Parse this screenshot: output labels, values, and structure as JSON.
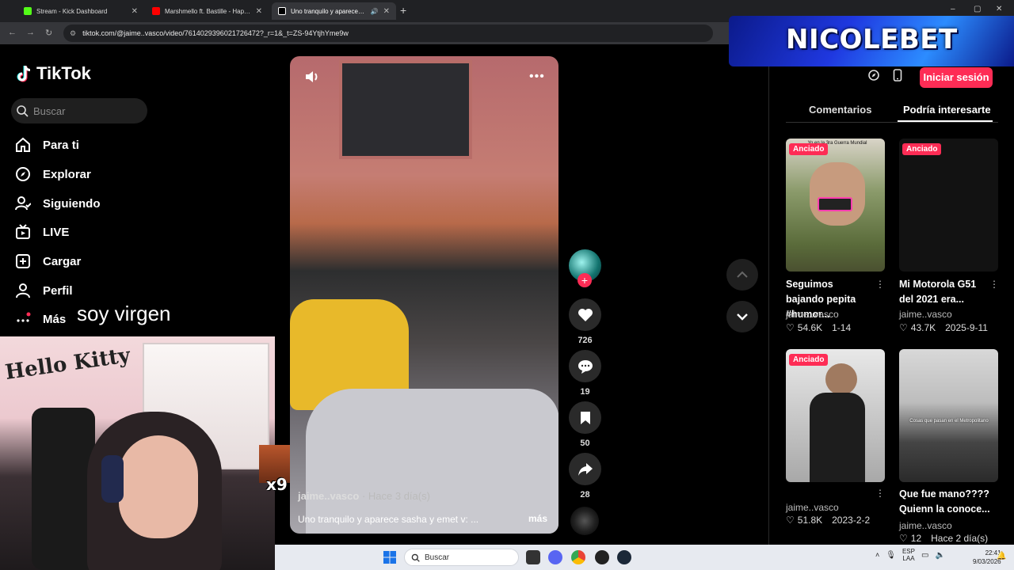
{
  "browser": {
    "tabs": [
      {
        "label": "Stream - Kick Dashboard",
        "favicon_color": "#53fc18"
      },
      {
        "label": "Marshmello ft. Bastille - Happier",
        "favicon_color": "#ff0000"
      },
      {
        "label": "Uno tranquilo y aparece sasha",
        "favicon_color": "#000000"
      }
    ],
    "url": "tiktok.com/@jaime..vasco/video/7614029396021726472?_r=1&_t=ZS-94YtjhYme9w",
    "window_controls": [
      "–",
      "▢",
      "✕"
    ]
  },
  "banner": {
    "text": "NICOLEBET"
  },
  "tiktok": {
    "logo": "TikTok",
    "search_placeholder": "Buscar",
    "nav": [
      {
        "label": "Para ti",
        "icon": "home-icon"
      },
      {
        "label": "Explorar",
        "icon": "compass-icon"
      },
      {
        "label": "Siguiendo",
        "icon": "following-icon"
      },
      {
        "label": "LIVE",
        "icon": "live-icon"
      },
      {
        "label": "Cargar",
        "icon": "upload-icon"
      },
      {
        "label": "Perfil",
        "icon": "profile-icon"
      },
      {
        "label": "Más",
        "icon": "more-icon"
      }
    ]
  },
  "overlay": {
    "caption": "soy virgen",
    "webcam_sign": "Hello Kitty",
    "emote_count": "x9"
  },
  "video": {
    "author": "jaime..vasco",
    "ago": "· Hace 3 día(s)",
    "description": "Uno tranquilo y aparece sasha y emet v: ...",
    "more": "más",
    "actions": {
      "likes": "726",
      "comments": "19",
      "saves": "50",
      "shares": "28"
    }
  },
  "right_panel": {
    "login": "Iniciar sesión",
    "tabs": [
      "Comentarios",
      "Podría interesarte"
    ],
    "active_tab": 1,
    "cards": [
      {
        "badge": "Anciado",
        "title": "Seguimos bajando pepita #humor...",
        "author": "jaime..vasco",
        "likes": "54.6K",
        "date": "1-14",
        "overlay_text": "Yo en la 3ra Guerra Mundial"
      },
      {
        "badge": "Anciado",
        "title": "Mi Motorola G51 del 2021 era...",
        "author": "jaime..vasco",
        "likes": "43.7K",
        "date": "2025-9-11",
        "overlay_text": ""
      },
      {
        "badge": "Anciado",
        "title": "",
        "author": "jaime..vasco",
        "likes": "51.8K",
        "date": "2023-2-2",
        "overlay_text": ""
      },
      {
        "badge": "",
        "title": "Que fue mano???? Quienn la conoce...",
        "author": "jaime..vasco",
        "likes": "12",
        "date": "Hace 2 día(s)",
        "overlay_text": "Cosas que pasan en el Metropolitano"
      }
    ]
  },
  "taskbar": {
    "search": "Buscar",
    "lang": "ESP",
    "lang_sub": "LAA",
    "time": "22:41",
    "date": "9/03/2026"
  },
  "colors": {
    "accent": "#fe2c55",
    "background": "#000000",
    "panel": "#1f1f1f"
  }
}
